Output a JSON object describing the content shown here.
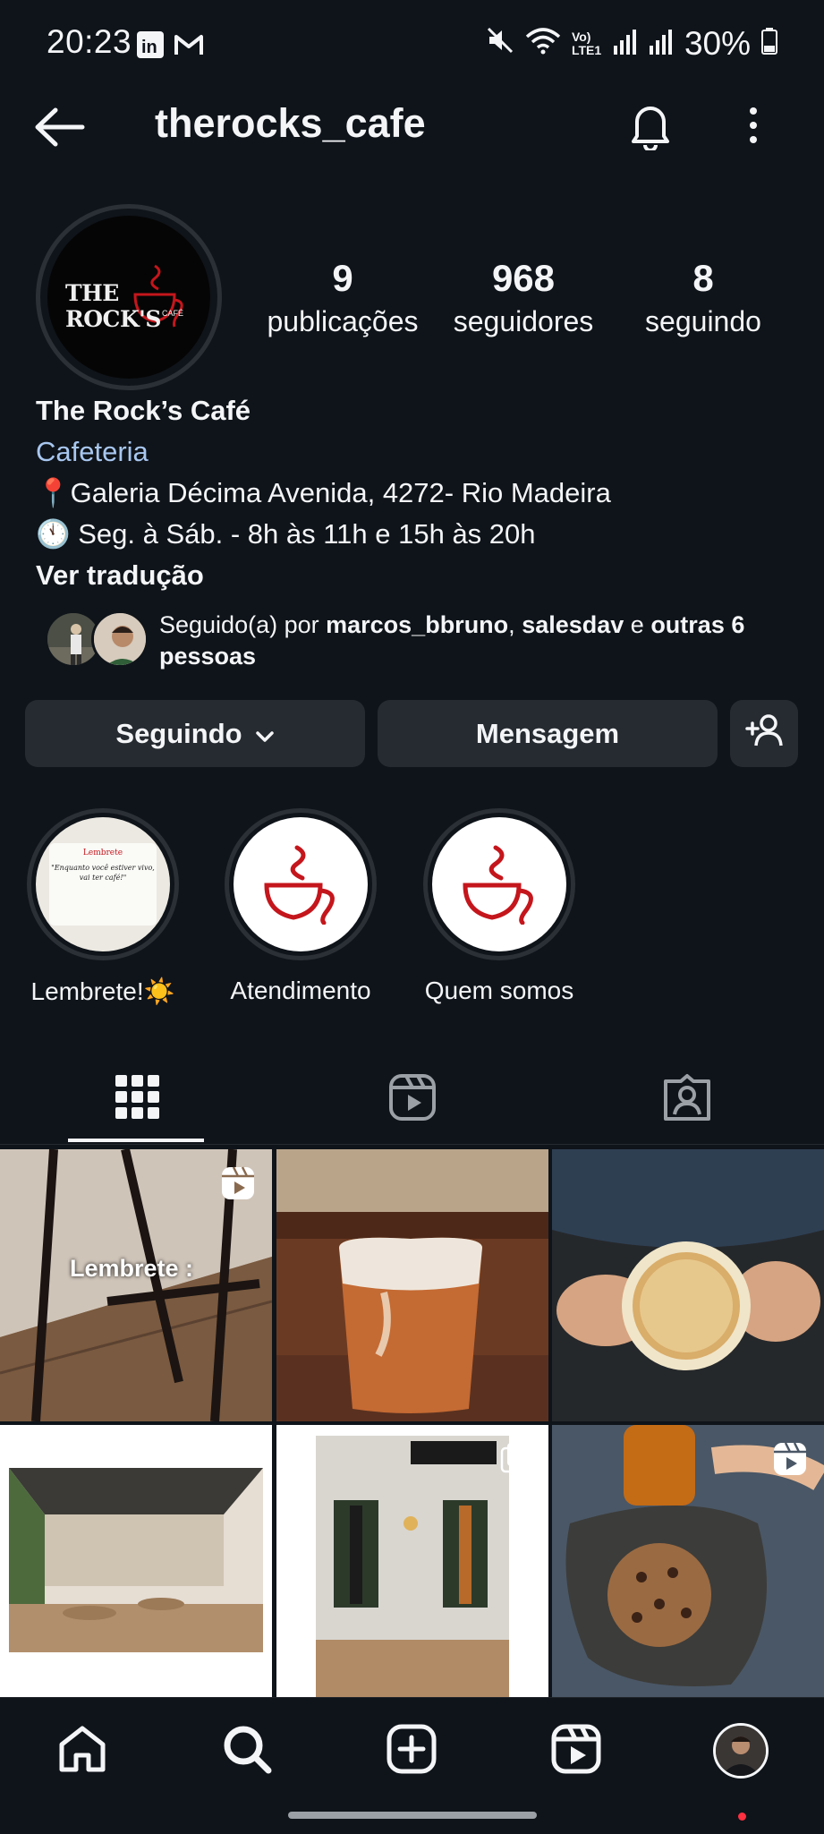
{
  "status_bar": {
    "time": "20:23",
    "battery": "30%",
    "network": "Vo) LTE1",
    "icons": [
      "linkedin-icon",
      "gmail-icon",
      "mute-icon",
      "wifi-icon",
      "signal-icon",
      "battery-icon"
    ]
  },
  "header": {
    "username": "therocks_cafe",
    "icons": [
      "back-arrow-icon",
      "bell-icon",
      "more-vertical-icon"
    ]
  },
  "profile": {
    "avatar_text": "THE ROCK'S",
    "avatar_subtext": "CAFÉ",
    "stats": [
      {
        "count": "9",
        "label": "publicações"
      },
      {
        "count": "968",
        "label": "seguidores"
      },
      {
        "count": "8",
        "label": "seguindo"
      }
    ],
    "name": "The Rock’s Café",
    "category": "Cafeteria",
    "address": "📍Galeria Décima Avenida, 4272- Rio Madeira",
    "hours": "🕚 Seg. à Sáb. - 8h às 11h e 15h às 20h",
    "translate": "Ver tradução"
  },
  "followed_by": {
    "prefix": "Seguido(a) por ",
    "user1": "marcos_bbruno",
    "sep": ", ",
    "user2": "salesdav",
    "mid": " e ",
    "others": "outras 6",
    "suffix": "pessoas"
  },
  "actions": {
    "following_label": "Seguindo",
    "message_label": "Mensagem"
  },
  "highlights": [
    {
      "label": "Lembrete!☀️",
      "card_title": "Lembrete",
      "card_text": "\"Enquanto você estiver vivo, vai ter café!\""
    },
    {
      "label": "Atendimento"
    },
    {
      "label": "Quem somos"
    }
  ],
  "grid": {
    "post1_text": "Lembrete :"
  },
  "colors": {
    "background": "#0f141a",
    "button": "#262b31",
    "category_link": "#a8c7f0",
    "brand_red": "#c4161c"
  }
}
